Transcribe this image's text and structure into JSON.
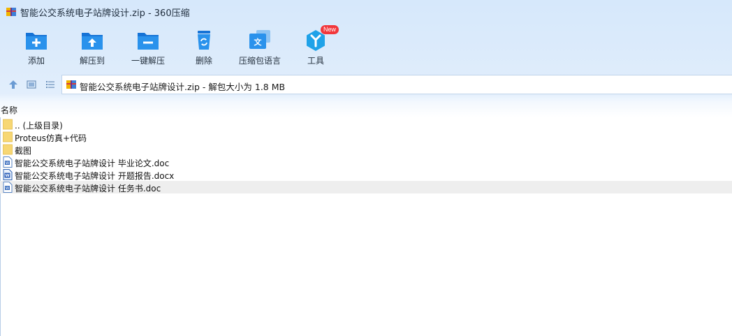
{
  "window": {
    "title": "智能公交系统电子站牌设计.zip - 360压缩"
  },
  "toolbar": {
    "buttons": [
      {
        "label": "添加",
        "icon": "add-folder-icon"
      },
      {
        "label": "解压到",
        "icon": "extract-to-icon"
      },
      {
        "label": "一键解压",
        "icon": "one-click-extract-icon"
      },
      {
        "label": "删除",
        "icon": "recycle-bin-icon"
      },
      {
        "label": "压缩包语言",
        "icon": "language-icon"
      },
      {
        "label": "工具",
        "icon": "tools-icon",
        "badge": "New"
      }
    ]
  },
  "address": {
    "text": "智能公交系统电子站牌设计.zip - 解包大小为 1.8 MB"
  },
  "list": {
    "column_name": "名称",
    "items": [
      {
        "name": ".. (上级目录)",
        "type": "folder"
      },
      {
        "name": "Proteus仿真+代码",
        "type": "folder"
      },
      {
        "name": "截图",
        "type": "folder"
      },
      {
        "name": "智能公交系统电子站牌设计 毕业论文.doc",
        "type": "doc"
      },
      {
        "name": "智能公交系统电子站牌设计 开题报告.docx",
        "type": "docx"
      },
      {
        "name": "智能公交系统电子站牌设计 任务书.doc",
        "type": "doc",
        "selected": true
      }
    ]
  },
  "colors": {
    "accent": "#1e88e5",
    "toolbar_bg": "#d6e8fb",
    "folder": "#f7d774",
    "badge": "#f2373b",
    "selected_row": "#eeeeee"
  }
}
